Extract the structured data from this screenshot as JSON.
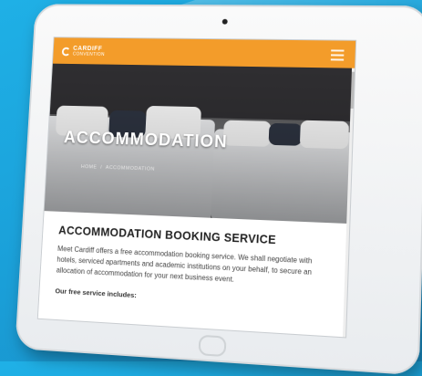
{
  "brand": {
    "name": "CARDIFF",
    "sub": "CONVENTION"
  },
  "hero": {
    "title": "ACCOMMODATION",
    "breadcrumb": [
      "HOME",
      "/",
      "ACCOMMODATION"
    ]
  },
  "content": {
    "section_title": "ACCOMMODATION BOOKING SERVICE",
    "intro": "Meet Cardiff offers a free accommodation booking service. We shall negotiate with hotels, serviced apartments and academic institutions on your behalf, to secure an allocation of accommodation for your next business event.",
    "includes_heading": "Our free service includes:"
  },
  "colors": {
    "accent": "#f39c2a",
    "background": "#1fb0e6"
  }
}
